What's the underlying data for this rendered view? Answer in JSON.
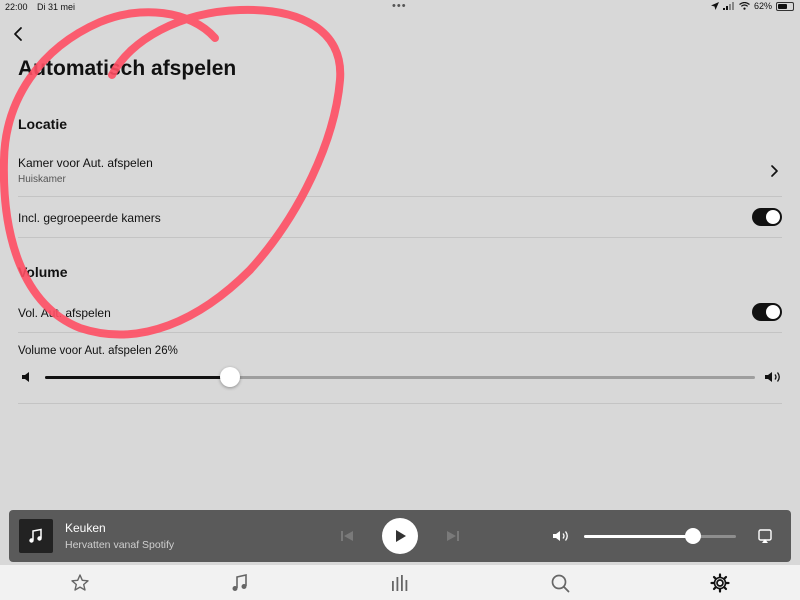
{
  "status_bar": {
    "time": "22:00",
    "date": "Di 31 mei",
    "battery": "62%",
    "battery_level": 0.62
  },
  "page": {
    "title": "Automatisch afspelen"
  },
  "sections": {
    "location": {
      "header": "Locatie",
      "room_label": "Kamer voor Aut. afspelen",
      "room_value": "Huiskamer",
      "grouped_label": "Incl. gegroepeerde kamers",
      "grouped_on": true
    },
    "volume": {
      "header": "Volume",
      "autoplay_volume_label": "Vol. Aut. afspelen",
      "autoplay_volume_on": true,
      "volume_label": "Volume voor Aut. afspelen 26%",
      "volume_level": 0.26
    }
  },
  "mini_player": {
    "room": "Keuken",
    "track": "Hervatten vanaf Spotify",
    "volume_level": 0.72
  },
  "tabs": [
    "favorites-tab",
    "music-tab",
    "rooms-tab",
    "search-tab",
    "settings-tab"
  ],
  "colors": {
    "background": "#d8d8d8",
    "annotation": "#ff4f64",
    "toggle_on": "#111111",
    "player_bg": "#5a5a5a"
  }
}
